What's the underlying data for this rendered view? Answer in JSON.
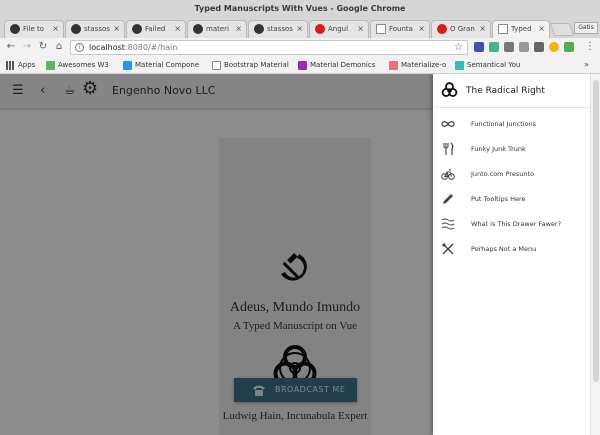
{
  "window": {
    "title": "Typed Manuscripts With Vues - Google Chrome"
  },
  "tabs": [
    {
      "label": "File to",
      "icon": "github-icon",
      "color": "#333333"
    },
    {
      "label": "stassos",
      "icon": "github-icon",
      "color": "#333333"
    },
    {
      "label": "Failed",
      "icon": "github-icon",
      "color": "#333333"
    },
    {
      "label": "materi",
      "icon": "github-icon",
      "color": "#333333"
    },
    {
      "label": "stassos",
      "icon": "github-icon",
      "color": "#333333"
    },
    {
      "label": "Angul",
      "icon": "angular-icon",
      "color": "#dd1b16"
    },
    {
      "label": "Founta",
      "icon": "document-icon",
      "color": "#888888"
    },
    {
      "label": "O Gran",
      "icon": "angular-icon",
      "color": "#dd1b16"
    },
    {
      "label": "Typed",
      "icon": "document-icon",
      "color": "#888888"
    }
  ],
  "profile_label": "Gatis",
  "address": {
    "host": "localhost",
    "rest": ":8080/#/hain"
  },
  "bookmarks": [
    {
      "label": "Apps",
      "icon": "apps-grid-icon",
      "color": "#555555"
    },
    {
      "label": "Awesomes W3",
      "icon": "w3-icon",
      "color": "#5cb85c"
    },
    {
      "label": "Material Compone",
      "icon": "material-icon",
      "color": "#2196f3"
    },
    {
      "label": "Bootstrap Material",
      "icon": "document-icon",
      "color": "#888888"
    },
    {
      "label": "Material Demonics",
      "icon": "material-demonics-icon",
      "color": "#9c27b0"
    },
    {
      "label": "Materialize-o",
      "icon": "materialize-icon",
      "color": "#ee6e73"
    },
    {
      "label": "Semantical You",
      "icon": "semantic-icon",
      "color": "#35bdb2"
    }
  ],
  "app": {
    "brand": "Engenho Novo LLC",
    "heading": "Adeus, Mundo Imundo",
    "subheading": "A Typed Manuscript on Vue",
    "author": "Ludwig Hain, Incunabula Expert",
    "button_label": "BROADCAST ME"
  },
  "drawer": {
    "title": "The Radical Right",
    "items": [
      {
        "label": "Functional Junctions",
        "icon": "infinity-icon"
      },
      {
        "label": "Funky Junk Trunk",
        "icon": "fork-knife-icon"
      },
      {
        "label": "Junto.com Presunto",
        "icon": "bicycle-icon"
      },
      {
        "label": "Put Tooltips Here",
        "icon": "pencil-icon"
      },
      {
        "label": "What is This Drawer Fawer?",
        "icon": "waves-icon"
      },
      {
        "label": "Perhaps Not a Menu",
        "icon": "crossed-utensils-icon"
      }
    ]
  },
  "colors": {
    "accent_button": "#3c6a84",
    "scrim": "rgba(0,0,0,0.42)"
  }
}
